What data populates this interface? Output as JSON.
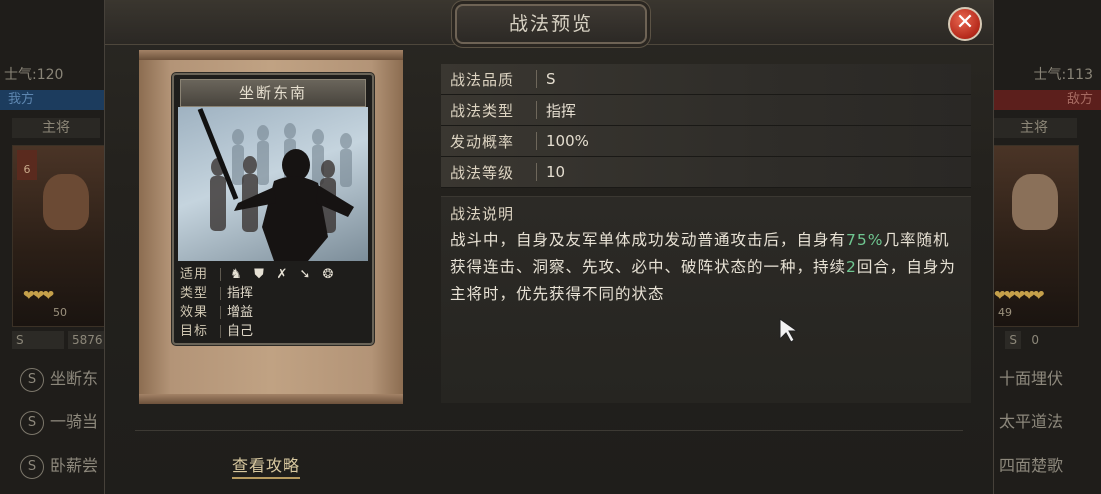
{
  "dialog": {
    "title": "战法预览",
    "close_icon": "close-icon"
  },
  "background": {
    "left": {
      "morale": "士气:120",
      "side_tag": "我方",
      "role": "主将",
      "portrait_level": "6",
      "troops": "50",
      "stat": "5876",
      "skills": [
        "坐断东",
        "一骑当",
        "卧薪尝"
      ]
    },
    "right": {
      "morale": "士气:113",
      "side_tag": "敌方",
      "role": "主将",
      "troops": "49",
      "stat": "0",
      "skills": [
        "十面埋伏",
        "太平道法",
        "四面楚歌"
      ]
    },
    "skill_badge": "S"
  },
  "card": {
    "name": "坐断东南",
    "attributes": [
      {
        "key": "适用",
        "value": ""
      },
      {
        "key": "类型",
        "value": "指挥"
      },
      {
        "key": "效果",
        "value": "增益"
      },
      {
        "key": "目标",
        "value": "自己"
      }
    ],
    "troop_icons": [
      "cavalry-icon",
      "shield-icon",
      "archer-icon",
      "spear-icon",
      "siege-icon"
    ]
  },
  "info": {
    "rows": [
      {
        "key": "战法品质",
        "value": "S"
      },
      {
        "key": "战法类型",
        "value": "指挥"
      },
      {
        "key": "发动概率",
        "value": "100%"
      },
      {
        "key": "战法等级",
        "value": "10"
      }
    ],
    "description_title": "战法说明",
    "description": {
      "part1": "战斗中，自身及友军单体成功发动普通攻击后，自身有",
      "highlight1": "75%",
      "part2": "几率随机获得连击、洞察、先攻、必中、破阵状态的一种，持续",
      "highlight2": "2",
      "part3": "回合，自身为主将时，优先获得不同的状态"
    }
  },
  "footer": {
    "guide_link": "查看攻略"
  },
  "colors": {
    "highlight": "#6fc690",
    "close_button": "#c53320"
  }
}
